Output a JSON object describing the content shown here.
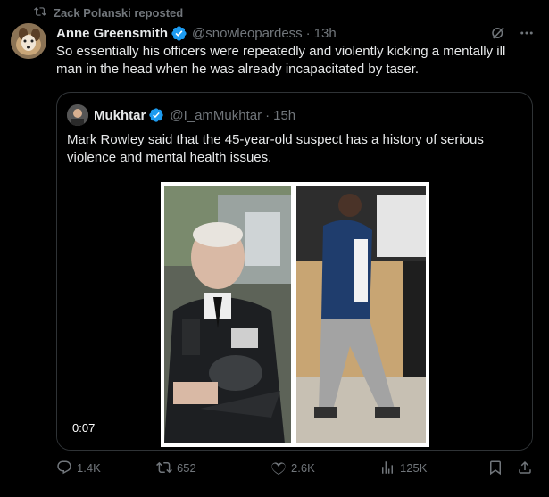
{
  "repost": {
    "label": "Zack Polanski reposted",
    "icon": "repost-icon"
  },
  "post": {
    "author_name": "Anne Greensmith",
    "handle": "@snowleopardess",
    "separator": "·",
    "time": "13h",
    "text": "So essentially his officers were repeatedly and violently kicking a mentally ill man in the head when he was already incapacitated by taser."
  },
  "quote": {
    "author_name": "Mukhtar",
    "handle": "@I_amMukhtar",
    "separator": "·",
    "time": "15h",
    "text": "Mark Rowley said that the 45-year-old suspect has a history of serious violence and mental health issues.",
    "video_duration": "0:07"
  },
  "actions": {
    "replies": "1.4K",
    "reposts": "652",
    "likes": "2.6K",
    "views": "125K"
  },
  "colors": {
    "accent": "#1d9bf0",
    "muted": "#71767b",
    "border": "#2f3336",
    "background": "#000000"
  }
}
